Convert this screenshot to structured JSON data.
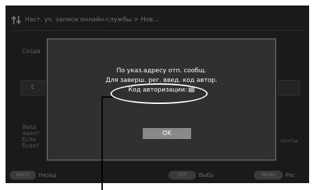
{
  "background": {
    "title": "Наст. уч. записи онлайн-службы > Нов...",
    "create_label": "Созда",
    "field_prefix": "E",
    "info_lines": [
      "Введ",
      "идент",
      "Если",
      "будет"
    ],
    "info_right": "почты"
  },
  "dialog": {
    "line1": "По указ.адресу отп. сообщ.",
    "line2": "Для заверш. рег. введ. код автор.",
    "auth_label": "Код авторизации:",
    "ok_label": "OK"
  },
  "footer": {
    "back_key": "BACK",
    "back_label": "Назад",
    "set_key": "SET",
    "set_label": "Выбр",
    "menu_key": "MENU",
    "menu_label": "Рег."
  },
  "colors": {
    "screen_bg": "#1a1a1a",
    "dialog_bg": "#303030",
    "ok_button": "#8a8a8a",
    "callout": "#ffffff"
  }
}
